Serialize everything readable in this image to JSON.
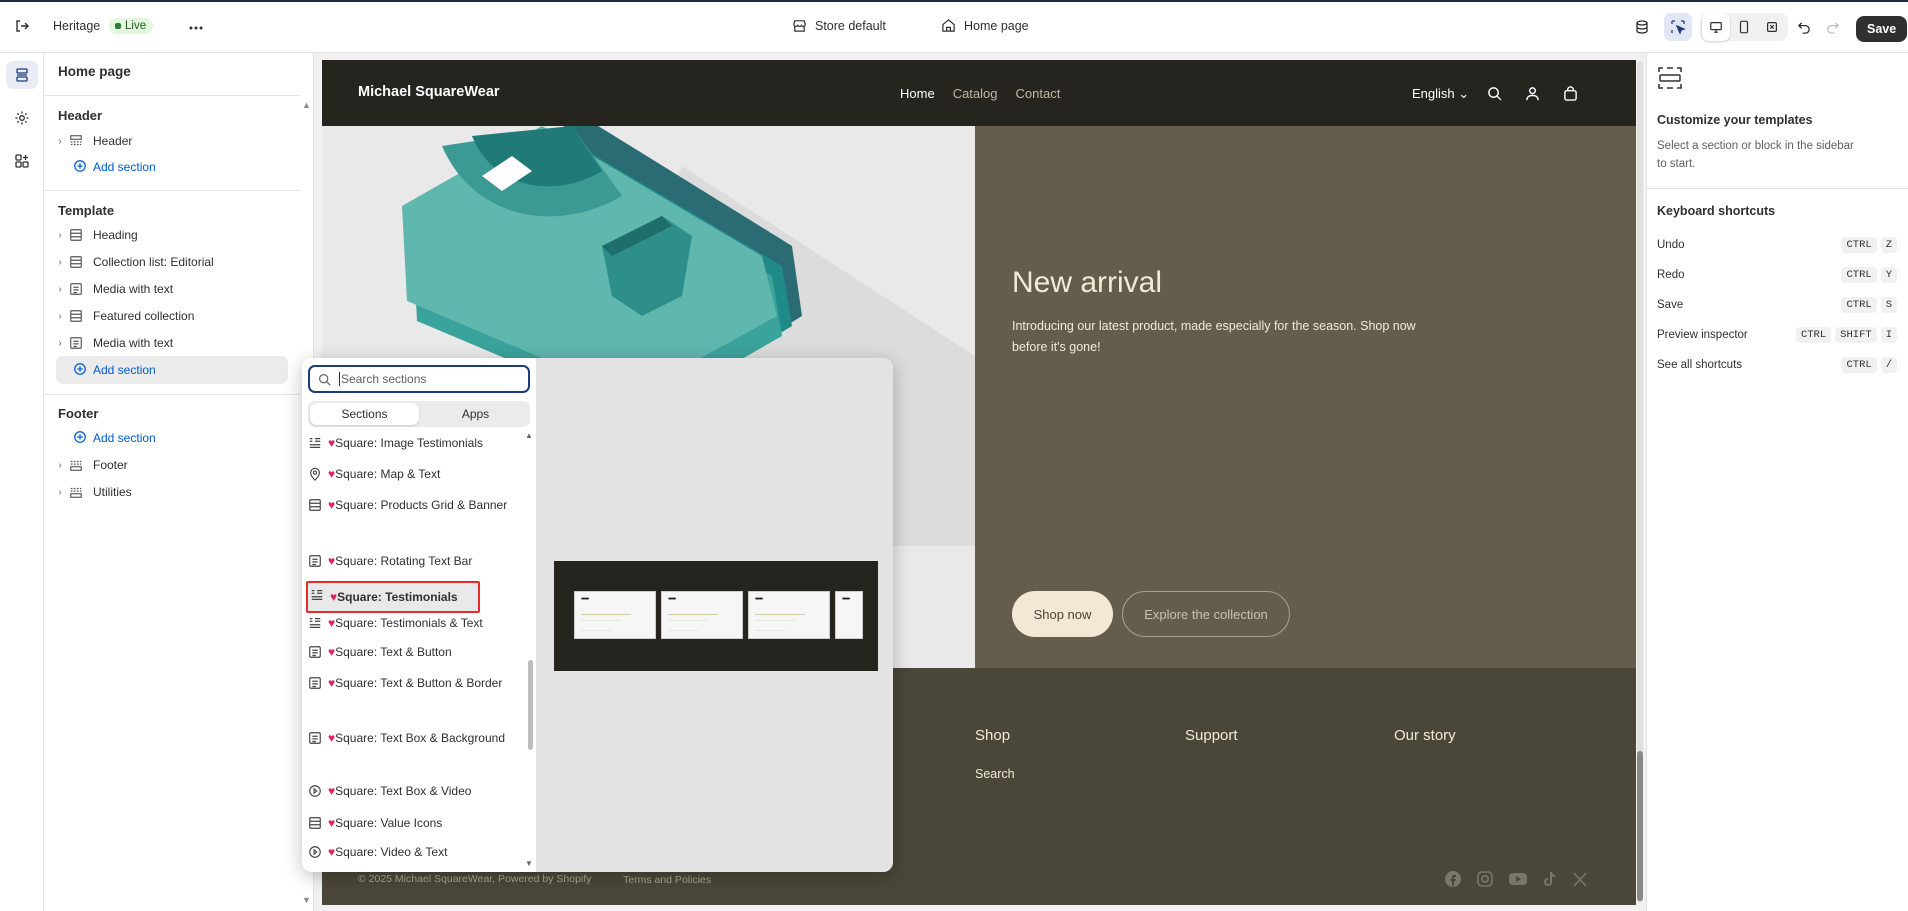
{
  "topbar": {
    "theme_name": "Heritage",
    "live_label": "Live",
    "store_selector": "Store default",
    "page_selector": "Home page",
    "save_label": "Save"
  },
  "sidebar": {
    "title": "Home page",
    "header_group": {
      "title": "Header",
      "items": [
        "Header"
      ],
      "add": "Add section"
    },
    "template_group": {
      "title": "Template",
      "items": [
        "Heading",
        "Collection list: Editorial",
        "Media with text",
        "Featured collection",
        "Media with text"
      ],
      "add": "Add section"
    },
    "footer_group": {
      "title": "Footer",
      "add": "Add section",
      "items": [
        "Footer",
        "Utilities"
      ]
    }
  },
  "store": {
    "logo": "Michael SquareWear",
    "nav": [
      "Home",
      "Catalog",
      "Contact"
    ],
    "language": "English",
    "hero": {
      "title": "New arrival",
      "text": "Introducing our latest product, made especially for the season. Shop now before it's gone!",
      "primary": "Shop now",
      "secondary": "Explore the collection"
    },
    "footer_cols": [
      "Shop",
      "Support",
      "Our story"
    ],
    "footer_link": "Search",
    "copyright": "© 2025 Michael SquareWear, Powered by Shopify",
    "terms": "Terms and Policies"
  },
  "picker": {
    "search_placeholder": "Search sections",
    "tabs": [
      "Sections",
      "Apps"
    ],
    "items": [
      {
        "label": "Square: Image Testimonials",
        "icon": "testimonials-icon"
      },
      {
        "label": "Square: Map & Text",
        "icon": "map-pin-icon"
      },
      {
        "label": "Square: Products Grid & Banner",
        "icon": "grid-icon"
      },
      {
        "label": "Square: Rotating Text Bar",
        "icon": "text-block-icon"
      },
      {
        "label": "Square: Testimonials",
        "icon": "testimonials-icon",
        "selected": true
      },
      {
        "label": "Square: Testimonials & Text",
        "icon": "testimonials-icon"
      },
      {
        "label": "Square: Text & Button",
        "icon": "text-block-icon"
      },
      {
        "label": "Square: Text & Button & Border",
        "icon": "text-block-icon"
      },
      {
        "label": "Square: Text Box & Background",
        "icon": "text-block-icon"
      },
      {
        "label": "Square: Text Box & Video",
        "icon": "play-icon"
      },
      {
        "label": "Square: Value Icons",
        "icon": "grid-icon"
      },
      {
        "label": "Square: Video & Text",
        "icon": "play-icon"
      }
    ],
    "preview_stars": "•••••"
  },
  "right": {
    "title": "Customize your templates",
    "desc": "Select a section or block in the sidebar to start.",
    "shortcuts_title": "Keyboard shortcuts",
    "shortcuts": [
      {
        "label": "Undo",
        "keys": [
          "CTRL",
          "Z"
        ]
      },
      {
        "label": "Redo",
        "keys": [
          "CTRL",
          "Y"
        ]
      },
      {
        "label": "Save",
        "keys": [
          "CTRL",
          "S"
        ]
      },
      {
        "label": "Preview inspector",
        "keys": [
          "CTRL",
          "SHIFT",
          "I"
        ]
      },
      {
        "label": "See all shortcuts",
        "keys": [
          "CTRL",
          "/"
        ]
      }
    ]
  },
  "colors": {
    "accent": "#005bd3",
    "selection_outline": "#e52b2b",
    "heart": "#e0245e",
    "hero_bg": "#655d4b",
    "nav_bg": "#25241f"
  }
}
